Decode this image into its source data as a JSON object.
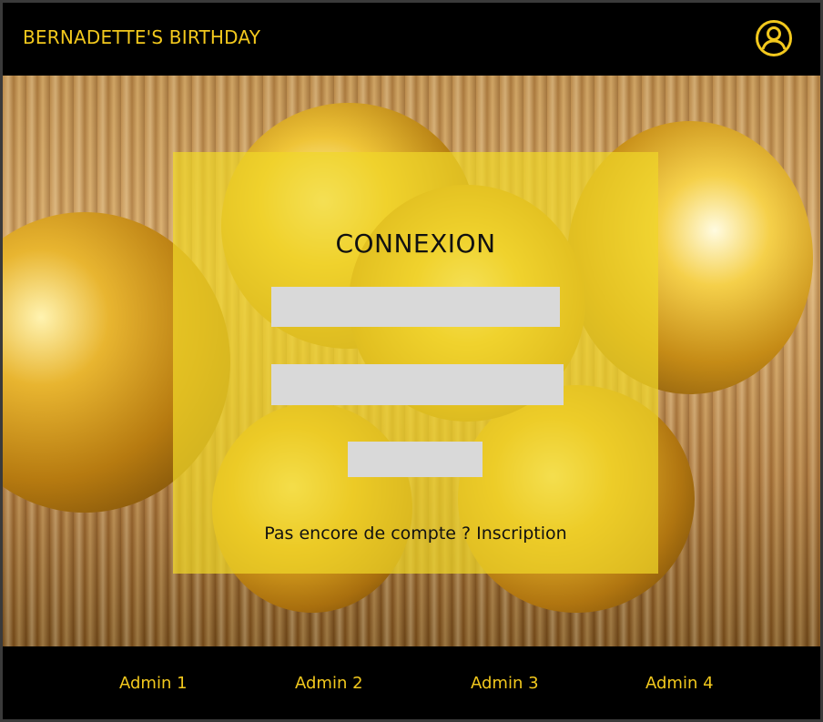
{
  "header": {
    "title": "BERNADETTE'S BIRTHDAY",
    "user_icon": "user-circle-icon"
  },
  "login": {
    "title": "CONNEXION",
    "field_1_value": "",
    "field_2_value": "",
    "submit_label": "",
    "signup_prompt": "Pas encore de compte ?",
    "signup_link": "Inscription"
  },
  "footer": {
    "links": [
      "Admin 1",
      "Admin 2",
      "Admin 3",
      "Admin 4"
    ]
  },
  "colors": {
    "accent": "#f2c81d",
    "card": "#f0d728",
    "input": "#d9d9d9",
    "bar": "#000000"
  }
}
